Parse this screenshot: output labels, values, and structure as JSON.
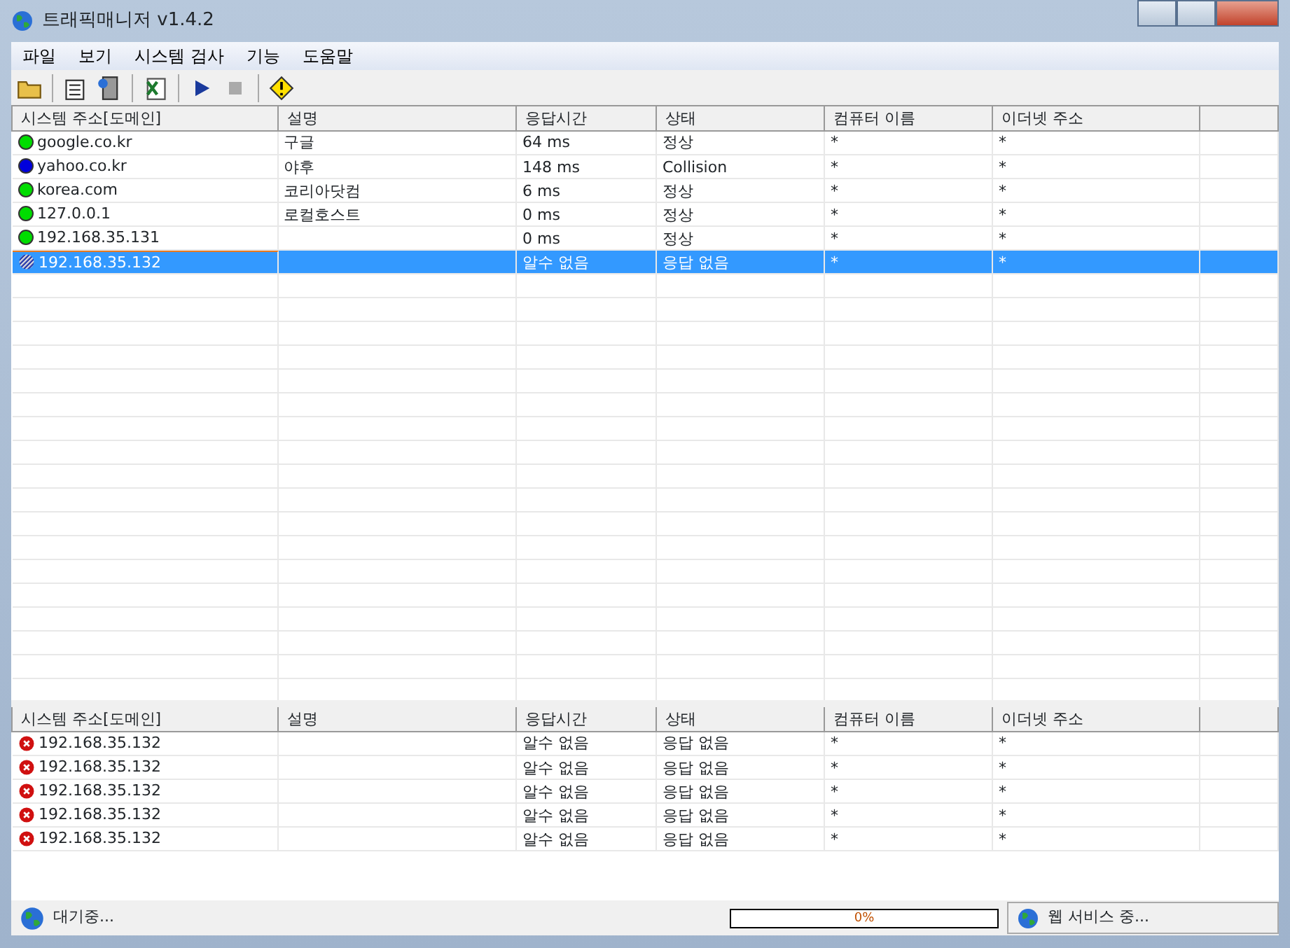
{
  "window": {
    "title": "트래픽매니저 v1.4.2"
  },
  "menu": [
    "파일",
    "보기",
    "시스템 검사",
    "기능",
    "도움말"
  ],
  "columns": [
    "시스템 주소[도메인]",
    "설명",
    "응답시간",
    "상태",
    "컴퓨터 이름",
    "이더넷 주소"
  ],
  "hosts": [
    {
      "kind": "dot",
      "color": "#00dd00",
      "selected": false,
      "cells": [
        "google.co.kr",
        "구글",
        "64 ms",
        "정상",
        "*",
        "*"
      ]
    },
    {
      "kind": "dot",
      "color": "#0000dd",
      "selected": false,
      "cells": [
        "yahoo.co.kr",
        "야후",
        "148 ms",
        "Collision",
        "*",
        "*"
      ]
    },
    {
      "kind": "dot",
      "color": "#00dd00",
      "selected": false,
      "cells": [
        "korea.com",
        "코리아닷컴",
        "6 ms",
        "정상",
        "*",
        "*"
      ]
    },
    {
      "kind": "dot",
      "color": "#00dd00",
      "selected": false,
      "cells": [
        "127.0.0.1",
        "로컬호스트",
        "0 ms",
        "정상",
        "*",
        "*"
      ]
    },
    {
      "kind": "dot",
      "color": "#00dd00",
      "selected": false,
      "cells": [
        "192.168.35.131",
        "",
        "0 ms",
        "정상",
        "*",
        "*"
      ]
    },
    {
      "kind": "striped",
      "selected": true,
      "cells": [
        "192.168.35.132",
        "",
        "알수 없음",
        "응답 없음",
        "*",
        "*"
      ]
    }
  ],
  "log_columns": [
    "시스템 주소[도메인]",
    "설명",
    "응답시간",
    "상태",
    "컴퓨터 이름",
    "이더넷 주소"
  ],
  "log": [
    {
      "kind": "error",
      "cells": [
        "192.168.35.132",
        "",
        "알수 없음",
        "응답 없음",
        "*",
        "*"
      ]
    },
    {
      "kind": "error",
      "cells": [
        "192.168.35.132",
        "",
        "알수 없음",
        "응답 없음",
        "*",
        "*"
      ]
    },
    {
      "kind": "error",
      "cells": [
        "192.168.35.132",
        "",
        "알수 없음",
        "응답 없음",
        "*",
        "*"
      ]
    },
    {
      "kind": "error",
      "cells": [
        "192.168.35.132",
        "",
        "알수 없음",
        "응답 없음",
        "*",
        "*"
      ]
    },
    {
      "kind": "error",
      "cells": [
        "192.168.35.132",
        "",
        "알수 없음",
        "응답 없음",
        "*",
        "*"
      ]
    }
  ],
  "status_bar": {
    "message": "대기중...",
    "progress": {
      "level": 0,
      "text": "0%"
    },
    "service": "웹 서비스 중..."
  }
}
